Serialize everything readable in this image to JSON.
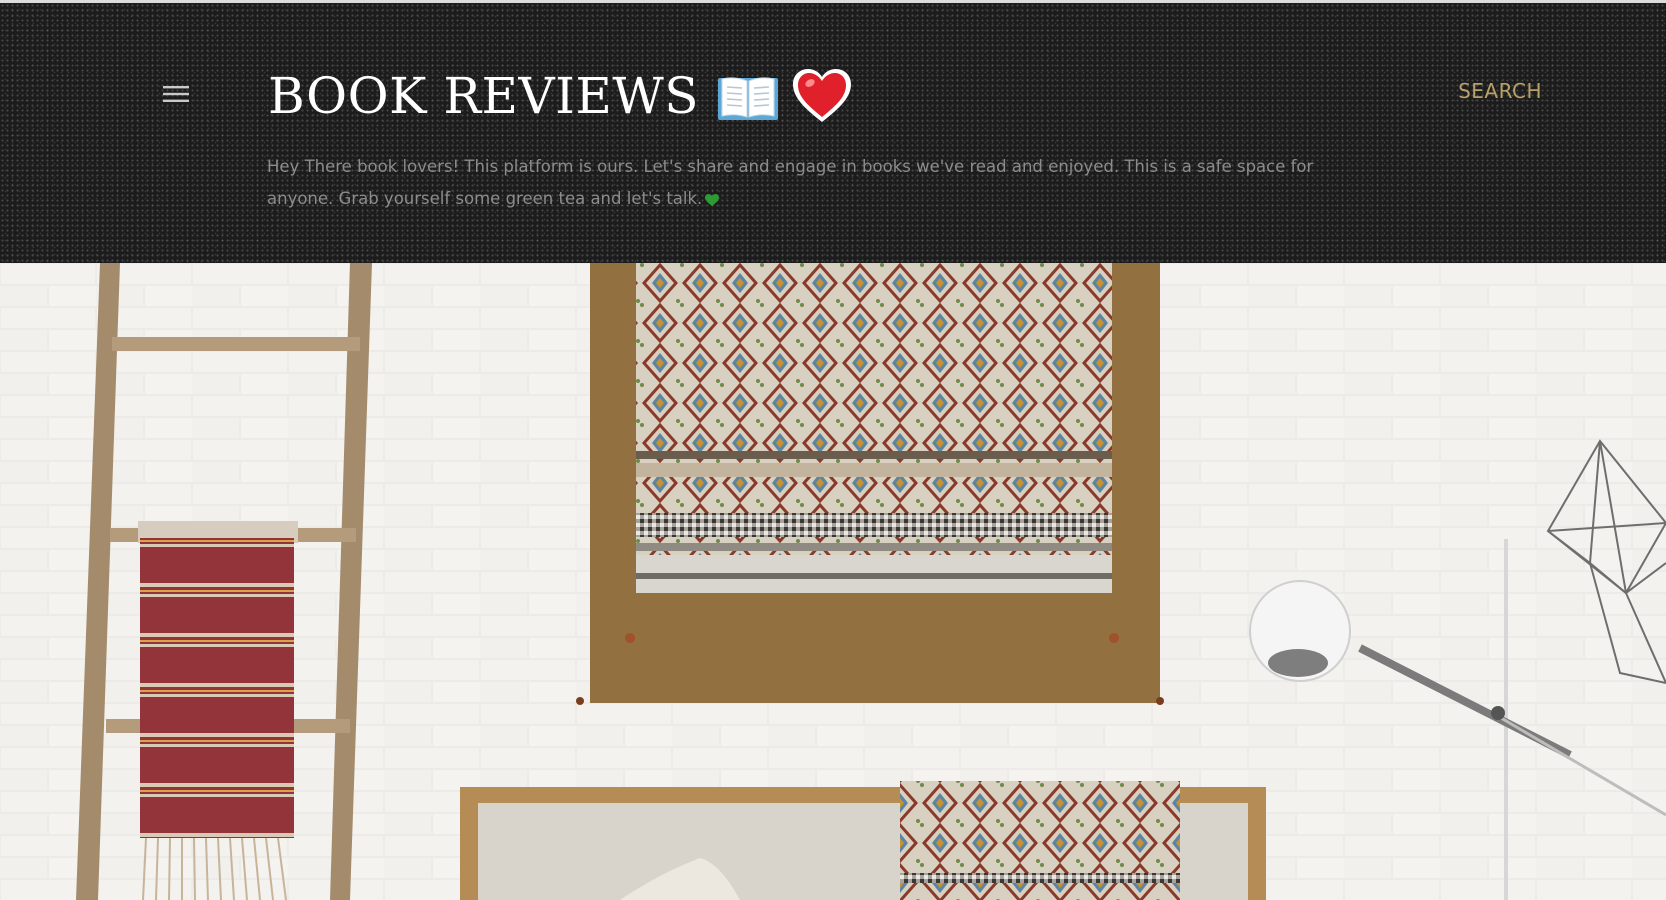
{
  "header": {
    "menu_icon": "hamburger-menu-icon",
    "title": "BOOK REVIEWS",
    "title_icons": [
      "open-book-icon",
      "red-heart-icon"
    ],
    "search_label": "SEARCH",
    "description": "Hey There book lovers! This platform is ours. Let's share and engage in books we've read and enjoyed. This is a safe space for anyone. Grab yourself some green tea and let's talk.",
    "description_icon": "green-heart-icon"
  },
  "hero": {
    "image": "hero-interior-photo"
  },
  "colors": {
    "header_background": "#1c1c1c",
    "title": "#ffffff",
    "search_accent": "#b8a06a",
    "description_text": "#8c8c8c",
    "heart_red": "#e0202a",
    "heart_green": "#2e9a33"
  }
}
